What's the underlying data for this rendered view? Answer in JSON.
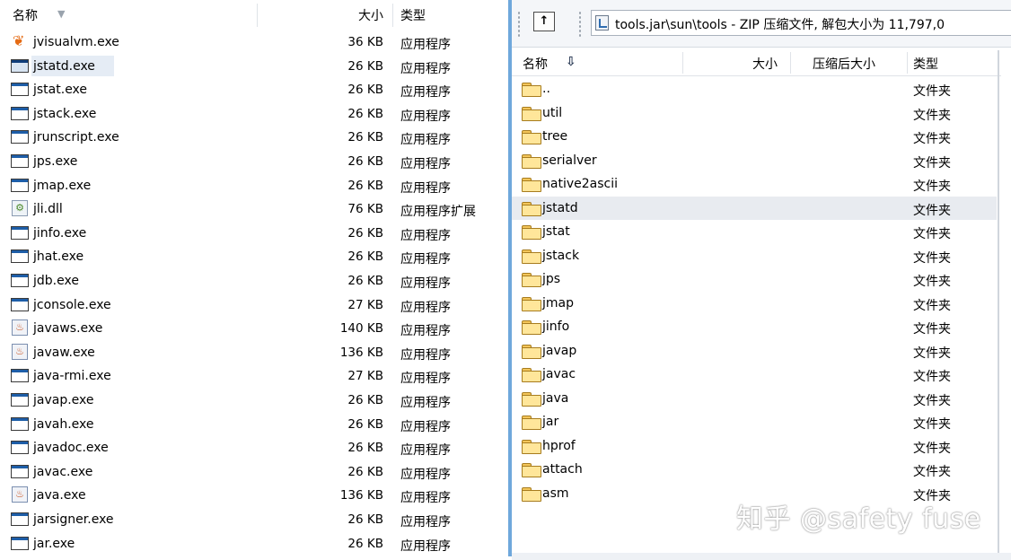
{
  "explorer": {
    "columns": {
      "name": "名称",
      "size": "大小",
      "type": "类型"
    },
    "selected_index": 1,
    "files": [
      {
        "name": "jvisualvm.exe",
        "size": "36 KB",
        "type": "应用程序",
        "icon": "jvisualvm-icon"
      },
      {
        "name": "jstatd.exe",
        "size": "26 KB",
        "type": "应用程序",
        "icon": "exe-icon"
      },
      {
        "name": "jstat.exe",
        "size": "26 KB",
        "type": "应用程序",
        "icon": "exe-icon"
      },
      {
        "name": "jstack.exe",
        "size": "26 KB",
        "type": "应用程序",
        "icon": "exe-icon"
      },
      {
        "name": "jrunscript.exe",
        "size": "26 KB",
        "type": "应用程序",
        "icon": "exe-icon"
      },
      {
        "name": "jps.exe",
        "size": "26 KB",
        "type": "应用程序",
        "icon": "exe-icon"
      },
      {
        "name": "jmap.exe",
        "size": "26 KB",
        "type": "应用程序",
        "icon": "exe-icon"
      },
      {
        "name": "jli.dll",
        "size": "76 KB",
        "type": "应用程序扩展",
        "icon": "dll-icon"
      },
      {
        "name": "jinfo.exe",
        "size": "26 KB",
        "type": "应用程序",
        "icon": "exe-icon"
      },
      {
        "name": "jhat.exe",
        "size": "26 KB",
        "type": "应用程序",
        "icon": "exe-icon"
      },
      {
        "name": "jdb.exe",
        "size": "26 KB",
        "type": "应用程序",
        "icon": "exe-icon"
      },
      {
        "name": "jconsole.exe",
        "size": "27 KB",
        "type": "应用程序",
        "icon": "exe-icon"
      },
      {
        "name": "javaws.exe",
        "size": "140 KB",
        "type": "应用程序",
        "icon": "java-icon"
      },
      {
        "name": "javaw.exe",
        "size": "136 KB",
        "type": "应用程序",
        "icon": "java-icon"
      },
      {
        "name": "java-rmi.exe",
        "size": "27 KB",
        "type": "应用程序",
        "icon": "exe-icon"
      },
      {
        "name": "javap.exe",
        "size": "26 KB",
        "type": "应用程序",
        "icon": "exe-icon"
      },
      {
        "name": "javah.exe",
        "size": "26 KB",
        "type": "应用程序",
        "icon": "exe-icon"
      },
      {
        "name": "javadoc.exe",
        "size": "26 KB",
        "type": "应用程序",
        "icon": "exe-icon"
      },
      {
        "name": "javac.exe",
        "size": "26 KB",
        "type": "应用程序",
        "icon": "exe-icon"
      },
      {
        "name": "java.exe",
        "size": "136 KB",
        "type": "应用程序",
        "icon": "java-icon"
      },
      {
        "name": "jarsigner.exe",
        "size": "26 KB",
        "type": "应用程序",
        "icon": "exe-icon"
      },
      {
        "name": "jar.exe",
        "size": "26 KB",
        "type": "应用程序",
        "icon": "exe-icon"
      }
    ]
  },
  "zip_window": {
    "up_icon_glyph": "↑",
    "path": "tools.jar\\sun\\tools - ZIP 压缩文件, 解包大小为 11,797,0",
    "columns": {
      "name": "名称",
      "sort_glyph": "⇩",
      "size": "大小",
      "compressed": "压缩后大小",
      "type": "类型"
    },
    "selected_index": 5,
    "folder_type": "文件夹",
    "folders": [
      "..",
      "util",
      "tree",
      "serialver",
      "native2ascii",
      "jstatd",
      "jstat",
      "jstack",
      "jps",
      "jmap",
      "jinfo",
      "javap",
      "javac",
      "java",
      "jar",
      "hprof",
      "attach",
      "asm"
    ]
  },
  "watermark": "知乎 @safety fuse"
}
